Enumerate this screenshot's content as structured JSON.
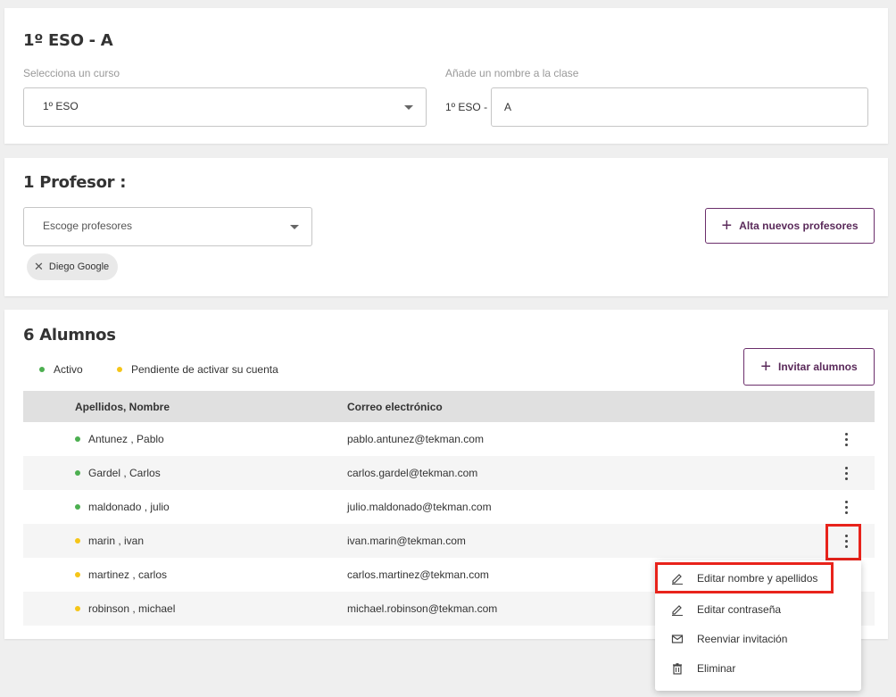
{
  "class_card": {
    "title": "1º ESO - A",
    "course_label": "Selecciona un curso",
    "course_value": "1º ESO",
    "name_label": "Añade un nombre a la clase",
    "name_prefix": "1º ESO -",
    "name_value": "A"
  },
  "teachers_card": {
    "title": "1 Profesor :",
    "select_placeholder": "Escoge profesores",
    "add_button": "Alta nuevos profesores",
    "chips": [
      {
        "label": "Diego Google"
      }
    ]
  },
  "students_card": {
    "title": "6 Alumnos",
    "legend_active": "Activo",
    "legend_pending": "Pendiente de activar su cuenta",
    "invite_button": "Invitar alumnos",
    "columns": [
      "Apellidos, Nombre",
      "Correo electrónico"
    ],
    "rows": [
      {
        "name": "Antunez , Pablo",
        "email": "pablo.antunez@tekman.com",
        "status": "active"
      },
      {
        "name": "Gardel , Carlos",
        "email": "carlos.gardel@tekman.com",
        "status": "active"
      },
      {
        "name": "maldonado , julio",
        "email": "julio.maldonado@tekman.com",
        "status": "active"
      },
      {
        "name": "marin , ivan",
        "email": "ivan.marin@tekman.com",
        "status": "pending"
      },
      {
        "name": "martinez , carlos",
        "email": "carlos.martinez@tekman.com",
        "status": "pending"
      },
      {
        "name": "robinson , michael",
        "email": "michael.robinson@tekman.com",
        "status": "pending"
      }
    ]
  },
  "context_menu": {
    "items": [
      {
        "label": "Editar nombre y apellidos",
        "icon": "pencil-icon"
      },
      {
        "label": "Editar contraseña",
        "icon": "pencil-icon"
      },
      {
        "label": "Reenviar invitación",
        "icon": "envelope-icon"
      },
      {
        "label": "Eliminar",
        "icon": "trash-icon"
      }
    ]
  },
  "colors": {
    "active": "#4caf50",
    "pending": "#f5c518",
    "accent": "#5a2a5a",
    "highlight": "#e8231b"
  }
}
